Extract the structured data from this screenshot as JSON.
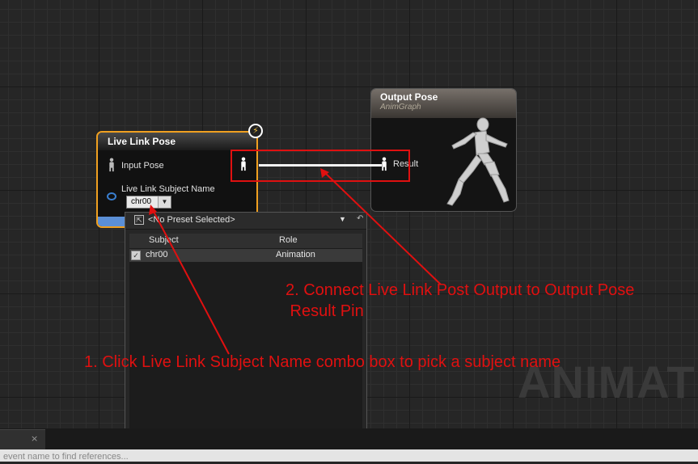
{
  "watermark": "ANIMATI",
  "live_link_node": {
    "title": "Live Link Pose",
    "input_pose_label": "Input Pose",
    "subject_name_label": "Live Link Subject Name",
    "combo_value": "chr00"
  },
  "output_node": {
    "title": "Output Pose",
    "subtitle": "AnimGraph",
    "result_label": "Result"
  },
  "dropdown": {
    "preset": "<No Preset Selected>",
    "columns": [
      "Subject",
      "Role"
    ],
    "rows": [
      {
        "subject": "chr00",
        "role": "Animation",
        "checked": true
      }
    ]
  },
  "annotations": {
    "step1": "1. Click Live Link Subject Name combo box to pick a subject name",
    "step2_line1": "2. Connect Live Link Post Output to Output Pose",
    "step2_line2": " Result Pin"
  },
  "bottom": {
    "tab_close": "×",
    "search_placeholder": "event name to find references..."
  },
  "colors": {
    "annotation_red": "#e01010",
    "selection_orange": "#f0a020",
    "pose_blue": "#5b8fd6"
  }
}
